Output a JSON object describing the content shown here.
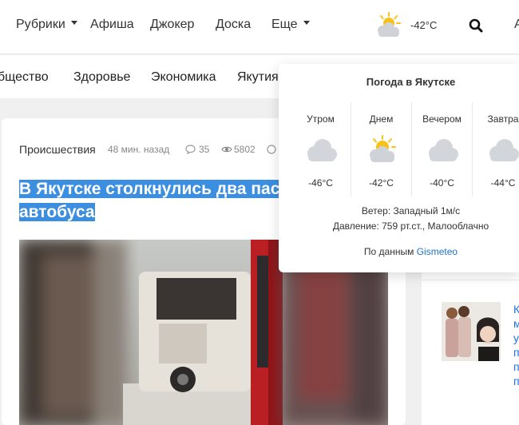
{
  "nav": {
    "rubrics": "Рубрики",
    "afisha": "Афиша",
    "joker": "Джокер",
    "board": "Доска",
    "more": "Еще",
    "edge_letter": "А"
  },
  "weather_widget": {
    "temp": "-42°C",
    "icon": "sun-cloud-icon"
  },
  "categories": [
    "бщество",
    "Здоровье",
    "Экономика",
    "Якутия"
  ],
  "article": {
    "rubric": "Происшествия",
    "time": "48 мин. назад",
    "comments": "35",
    "views": "5802",
    "title_line1": "В Якутске столкнулись два пас",
    "title_line2": "автобуса"
  },
  "popup": {
    "title": "Погода в Якутске",
    "columns": [
      {
        "label": "Утром",
        "temp": "-46°C",
        "icon": "cloud-icon"
      },
      {
        "label": "Днем",
        "temp": "-42°C",
        "icon": "sun-cloud-icon"
      },
      {
        "label": "Вечером",
        "temp": "-40°C",
        "icon": "cloud-icon"
      },
      {
        "label": "Завтра",
        "temp": "-44°C",
        "icon": "cloud-icon"
      }
    ],
    "wind": "Ветер: Западный 1м/с",
    "pressure": "Давление: 759 рт.ст., Малооблачно",
    "source_prefix": "По данным ",
    "source_link": "Gismeteo"
  },
  "sidebar": {
    "letters": [
      "К",
      "м",
      "у",
      "п",
      "п",
      "п"
    ]
  },
  "colors": {
    "accent": "#3b8ee0",
    "link": "#1e74c9",
    "sun": "#f7c21a"
  }
}
